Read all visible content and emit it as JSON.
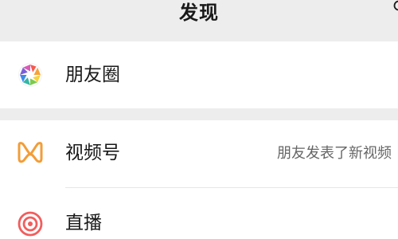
{
  "header": {
    "title": "发现"
  },
  "groups": [
    {
      "items": [
        {
          "label": "朋友圈",
          "icon": "moments-icon"
        }
      ]
    },
    {
      "items": [
        {
          "label": "视频号",
          "icon": "channels-icon",
          "hint": "朋友发表了新视频"
        },
        {
          "label": "直播",
          "icon": "live-icon"
        }
      ]
    }
  ],
  "colors": {
    "background": "#ededed",
    "card": "#ffffff",
    "channels_accent": "#f29d38",
    "live_accent": "#f25d5d",
    "hint_text": "#666666"
  }
}
